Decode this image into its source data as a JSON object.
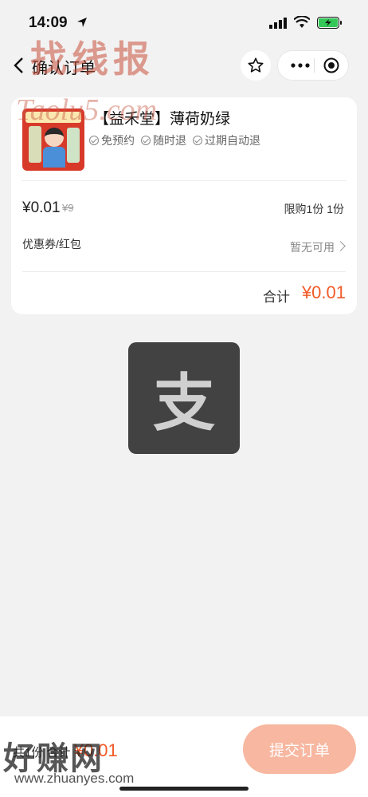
{
  "status_bar": {
    "time": "14:09"
  },
  "nav": {
    "title": "确认订单"
  },
  "watermark": {
    "top": "找线报",
    "taolu": "Taolu5.com",
    "bottom": "好赚网",
    "url": "www.zhuanyes.com"
  },
  "product": {
    "title": "【益禾堂】薄荷奶绿",
    "tags": [
      "免预约",
      "随时退",
      "过期自动退"
    ],
    "price": "¥0.01",
    "original_price": "¥9",
    "limit": "限购1份  1份"
  },
  "coupon": {
    "label": "优惠券/红包",
    "value": "暂无可用"
  },
  "total": {
    "label": "合计",
    "value": "¥0.01"
  },
  "loader": {
    "glyph": "支"
  },
  "bottom": {
    "summary_prefix": "共1份 合计",
    "summary_amount": "¥0.01",
    "submit_label": "提交订单"
  },
  "colors": {
    "accent": "#f05a28",
    "submit_bg": "#f7b7a0",
    "loader_bg": "#424242"
  }
}
